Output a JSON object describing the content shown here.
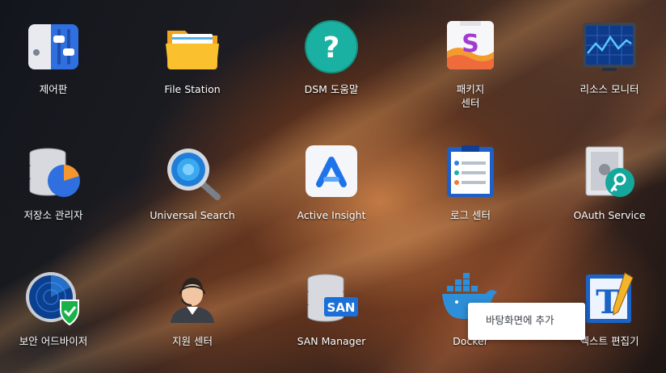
{
  "apps": [
    {
      "label": "제어판",
      "icon": "control-panel-icon"
    },
    {
      "label": "File Station",
      "icon": "folder-icon"
    },
    {
      "label": "DSM 도움말",
      "icon": "help-icon"
    },
    {
      "label": "패키지\n센터",
      "icon": "package-center-icon"
    },
    {
      "label": "리소스 모니터",
      "icon": "resource-monitor-icon"
    },
    {
      "label": "저장소 관리자",
      "icon": "storage-manager-icon"
    },
    {
      "label": "Universal Search",
      "icon": "magnifier-icon"
    },
    {
      "label": "Active Insight",
      "icon": "active-insight-icon"
    },
    {
      "label": "로그 센터",
      "icon": "log-center-icon"
    },
    {
      "label": "OAuth Service",
      "icon": "oauth-key-icon"
    },
    {
      "label": "보안 어드바이저",
      "icon": "security-radar-icon"
    },
    {
      "label": "지원 센터",
      "icon": "support-agent-icon"
    },
    {
      "label": "SAN Manager",
      "icon": "san-manager-icon"
    },
    {
      "label": "Docker",
      "icon": "docker-whale-icon"
    },
    {
      "label": "텍스트 편집기",
      "icon": "text-editor-icon"
    }
  ],
  "san_badge": "SAN",
  "text_editor_glyph": "T",
  "help_glyph": "?",
  "package_glyph": "S",
  "context_menu": {
    "items": [
      "바탕화면에 추가"
    ]
  }
}
